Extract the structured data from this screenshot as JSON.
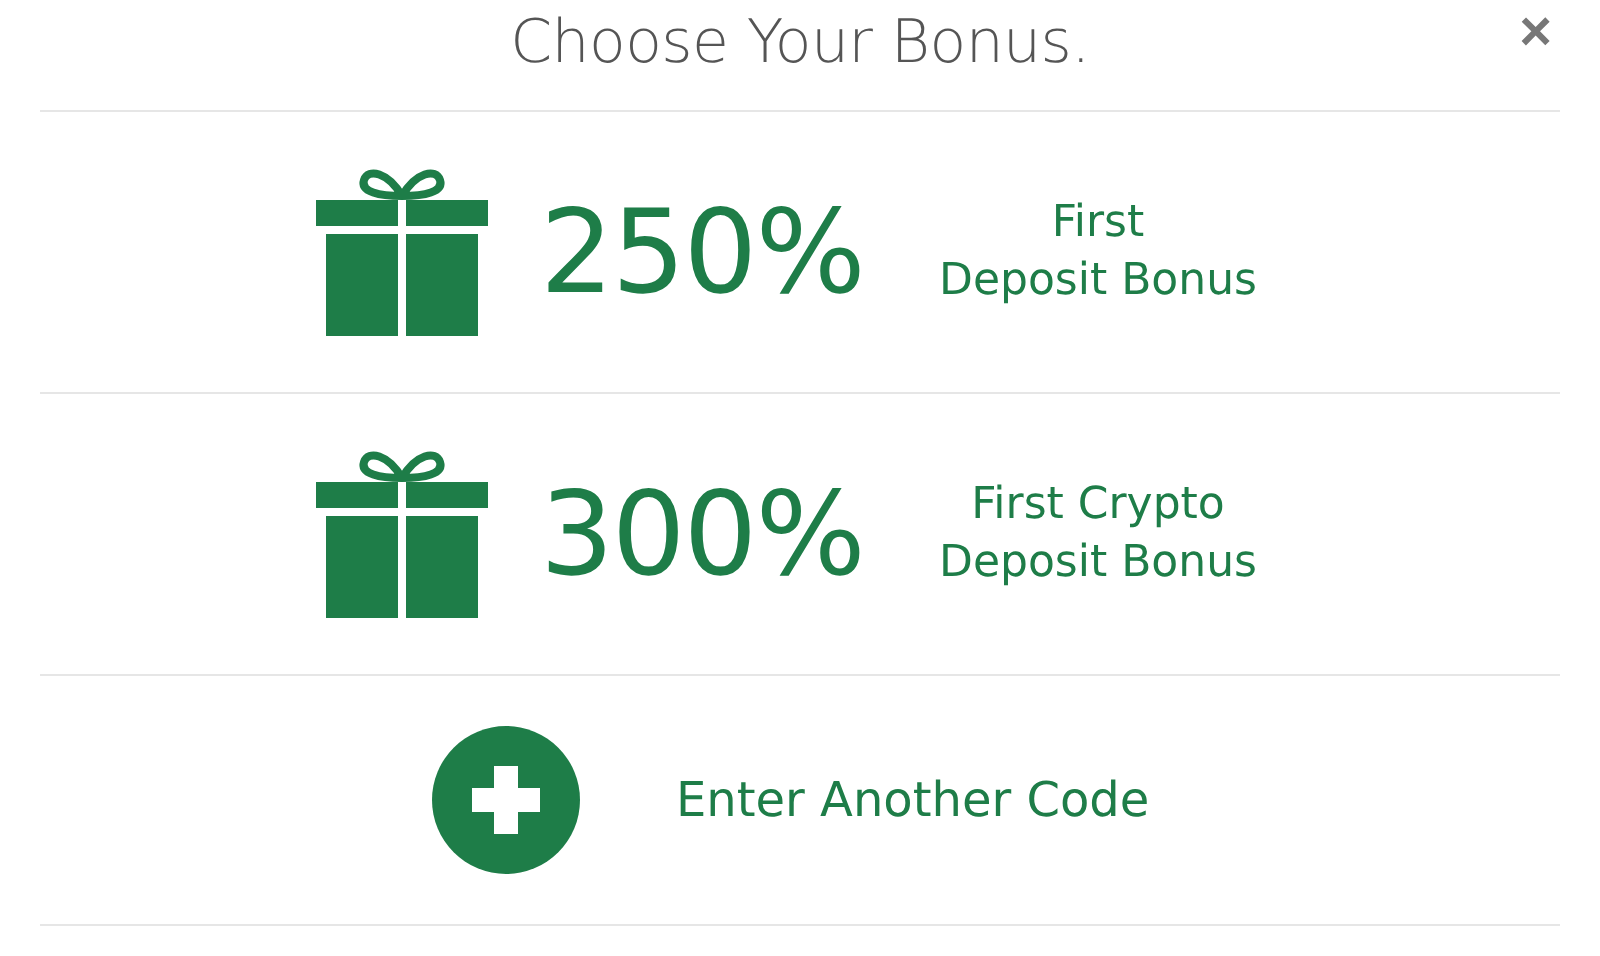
{
  "dialog": {
    "title": "Choose Your Bonus.",
    "close": "×"
  },
  "options": [
    {
      "kind": "bonus",
      "amount": "250%",
      "label_lines": [
        "First",
        "Deposit Bonus"
      ]
    },
    {
      "kind": "bonus",
      "amount": "300%",
      "label_lines": [
        "First Crypto",
        "Deposit Bonus"
      ]
    },
    {
      "kind": "code",
      "label": "Enter Another Code"
    }
  ]
}
